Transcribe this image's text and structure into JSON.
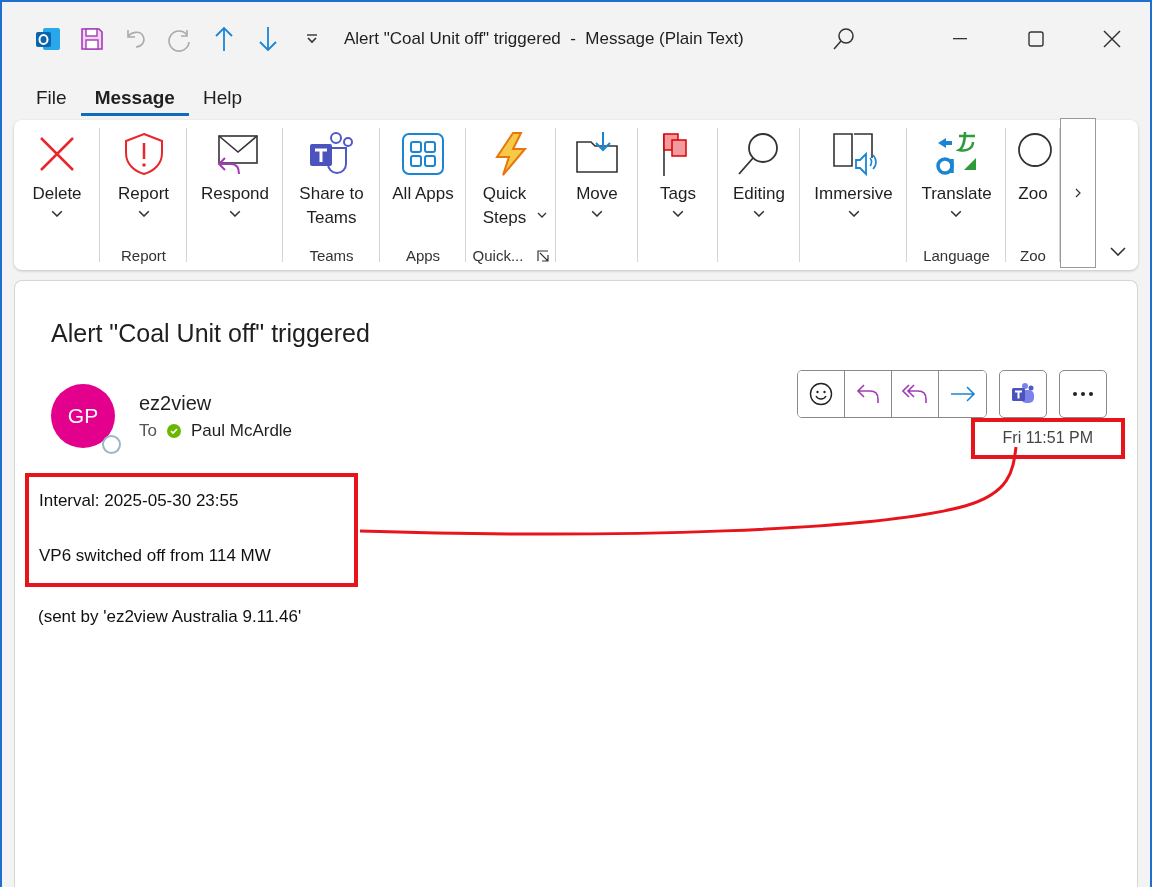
{
  "window": {
    "title": "Alert \"Coal Unit off\" triggered  -  Message (Plain Text)"
  },
  "menu_tabs": [
    {
      "label": "File",
      "selected": false
    },
    {
      "label": "Message",
      "selected": true
    },
    {
      "label": "Help",
      "selected": false
    }
  ],
  "ribbon": {
    "groups": [
      {
        "buttons": [
          {
            "label": "Delete",
            "kind": "delete",
            "has_menu": true
          }
        ]
      },
      {
        "label": "Report",
        "buttons": [
          {
            "label": "Report",
            "kind": "report",
            "has_menu": true
          }
        ]
      },
      {
        "buttons": [
          {
            "label": "Respond",
            "kind": "respond",
            "has_menu": true
          }
        ]
      },
      {
        "label": "Teams",
        "buttons": [
          {
            "label": "Share to Teams",
            "kind": "teams",
            "has_menu": false
          }
        ]
      },
      {
        "label": "Apps",
        "buttons": [
          {
            "label": "All Apps",
            "kind": "apps",
            "has_menu": false
          }
        ]
      },
      {
        "label": "Quick...",
        "launcher": true,
        "buttons": [
          {
            "label": "Quick Steps",
            "kind": "bolt",
            "has_menu": true,
            "inline_menu": true
          }
        ]
      },
      {
        "buttons": [
          {
            "label": "Move",
            "kind": "move",
            "has_menu": true
          }
        ]
      },
      {
        "buttons": [
          {
            "label": "Tags",
            "kind": "flag",
            "has_menu": true
          }
        ]
      },
      {
        "buttons": [
          {
            "label": "Editing",
            "kind": "search",
            "has_menu": true
          }
        ]
      },
      {
        "buttons": [
          {
            "label": "Immersive",
            "kind": "reader",
            "has_menu": true
          }
        ]
      },
      {
        "label": "Language",
        "buttons": [
          {
            "label": "Translate",
            "kind": "translate",
            "has_menu": true
          }
        ]
      },
      {
        "label": "Zoo",
        "buttons": [
          {
            "label": "Zoo",
            "kind": "zoom",
            "has_menu": false
          }
        ]
      }
    ]
  },
  "message": {
    "subject": "Alert \"Coal Unit off\" triggered",
    "avatar_initials": "GP",
    "sender": "ez2view",
    "to_label": "To",
    "recipient": "Paul McArdle",
    "time": "Fri 11:51 PM",
    "body": [
      "Interval: 2025-05-30 23:55",
      "VP6 switched off from 114 MW"
    ],
    "footer": "(sent by 'ez2view Australia 9.11.46'"
  }
}
